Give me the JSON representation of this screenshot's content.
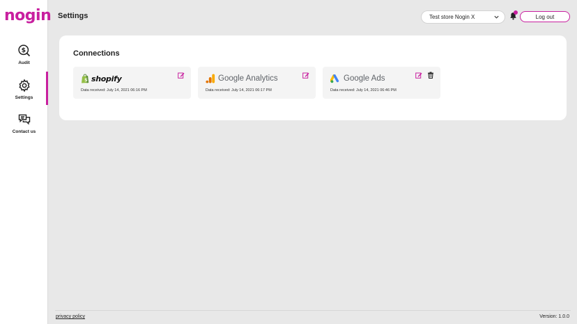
{
  "app": {
    "logo_text": "nogin"
  },
  "sidebar": {
    "items": [
      {
        "label": "Audit",
        "icon": "dollar-search-icon"
      },
      {
        "label": "Settings",
        "icon": "gear-icon",
        "active": true
      },
      {
        "label": "Contact us",
        "icon": "chat-bubbles-icon"
      }
    ]
  },
  "header": {
    "title": "Settings",
    "store_selected": "Test store Nogin X",
    "notification_icon": "bell-icon",
    "logout_label": "Log out"
  },
  "connections": {
    "title": "Connections",
    "cards": [
      {
        "name": "shopify",
        "date": "Data received: July 14, 2021 06:16 PM",
        "editable": true,
        "deletable": false
      },
      {
        "name": "Google Analytics",
        "date": "Data received: July 14, 2021 06:17 PM",
        "editable": true,
        "deletable": false
      },
      {
        "name": "Google Ads",
        "date": "Data received: July 14, 2021 06:46 PM",
        "editable": true,
        "deletable": true
      }
    ]
  },
  "footer": {
    "privacy_label": "privacy policy",
    "version": "Version: 1.0.0"
  },
  "colors": {
    "accent": "#c81f9f",
    "background": "#e8e8e8",
    "card": "#f4f4f4"
  }
}
